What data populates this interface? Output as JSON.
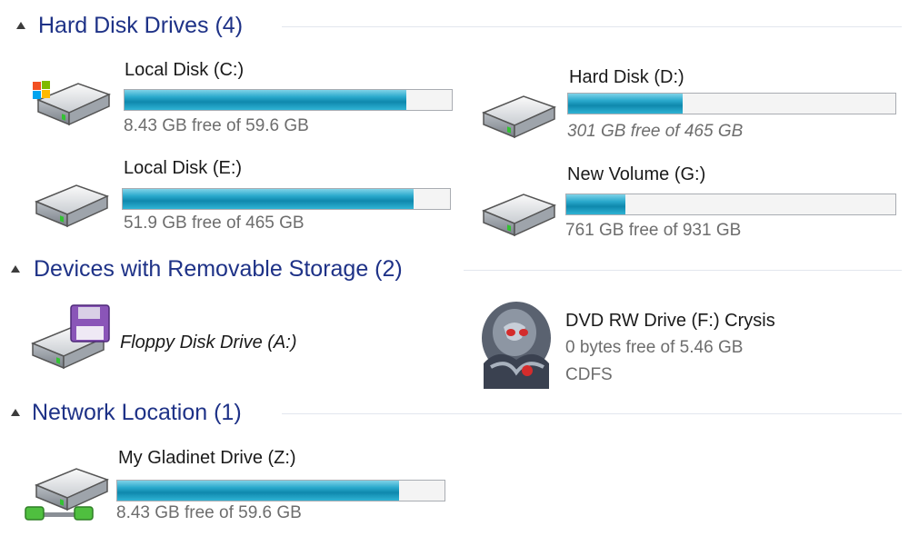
{
  "groups": {
    "hdd": {
      "title": "Hard Disk Drives (4)",
      "drives": [
        {
          "name": "Local Disk (C:)",
          "free": "8.43 GB free of 59.6 GB",
          "used_fraction": 0.86,
          "icon": "windows-drive-icon"
        },
        {
          "name": "Hard Disk (D:)",
          "free": "301 GB free of 465 GB",
          "used_fraction": 0.35,
          "icon": "hard-drive-icon"
        },
        {
          "name": "Local Disk (E:)",
          "free": "51.9 GB free of 465 GB",
          "used_fraction": 0.89,
          "icon": "hard-drive-icon"
        },
        {
          "name": "New Volume (G:)",
          "free": "761 GB free of 931 GB",
          "used_fraction": 0.18,
          "icon": "hard-drive-icon"
        }
      ]
    },
    "removable": {
      "title": "Devices with Removable Storage (2)",
      "floppy": {
        "name": "Floppy Disk Drive (A:)",
        "icon": "floppy-drive-icon"
      },
      "dvd": {
        "name": "DVD RW Drive (F:) Crysis",
        "free": "0 bytes free of 5.46 GB",
        "fs": "CDFS",
        "icon": "crysis-disc-icon"
      }
    },
    "network": {
      "title": "Network Location (1)",
      "drive": {
        "name": "My Gladinet Drive (Z:)",
        "free": "8.43 GB free of 59.6 GB",
        "used_fraction": 0.86,
        "icon": "network-drive-icon"
      }
    }
  },
  "colors": {
    "group_title": "#1e3287",
    "bar_fill": "#1797be",
    "sub_text": "#6d6d6d"
  }
}
